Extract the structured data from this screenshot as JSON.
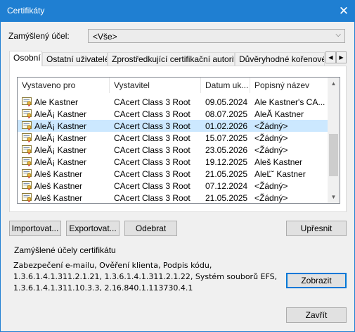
{
  "window": {
    "title": "Certifikáty",
    "close_glyph": "✕"
  },
  "purpose": {
    "label": "Zamýšlený účel:",
    "value": "<Vše>"
  },
  "tabs": [
    {
      "label": "Osobní"
    },
    {
      "label": "Ostatní uživatelé"
    },
    {
      "label": "Zprostředkující certifikační autority"
    },
    {
      "label": "Důvěryhodné kořenové certifikační autority"
    }
  ],
  "table": {
    "headers": [
      "Vystaveno pro",
      "Vystavitel",
      "Datum uk...",
      "Popisný název"
    ],
    "rows": [
      {
        "issued_to": "Ale Kastner",
        "issuer": "CAcert Class 3 Root",
        "expires": "09.05.2024",
        "friendly": "Ale Kastner's CA..."
      },
      {
        "issued_to": "AleĂ¡ Kastner",
        "issuer": "CAcert Class 3 Root",
        "expires": "08.07.2025",
        "friendly": "AleĂ Kastner"
      },
      {
        "issued_to": "AleĂ¡ Kastner",
        "issuer": "CAcert Class 3 Root",
        "expires": "01.02.2026",
        "friendly": "<Žádný>"
      },
      {
        "issued_to": "AleĂ¡ Kastner",
        "issuer": "CAcert Class 3 Root",
        "expires": "15.07.2025",
        "friendly": "<Žádný>"
      },
      {
        "issued_to": "AleĂ¡ Kastner",
        "issuer": "CAcert Class 3 Root",
        "expires": "23.05.2026",
        "friendly": "<Žádný>"
      },
      {
        "issued_to": "AleĂ¡ Kastner",
        "issuer": "CAcert Class 3 Root",
        "expires": "19.12.2025",
        "friendly": "Aleš Kastner"
      },
      {
        "issued_to": "Aleš Kastner",
        "issuer": "CAcert Class 3 Root",
        "expires": "21.05.2025",
        "friendly": "AleĽ˘ Kastner"
      },
      {
        "issued_to": "Aleš Kastner",
        "issuer": "CAcert Class 3 Root",
        "expires": "07.12.2024",
        "friendly": "<Žádný>"
      },
      {
        "issued_to": "Aleš Kastner",
        "issuer": "CAcert Class 3 Root",
        "expires": "21.05.2025",
        "friendly": "<Žádný>"
      }
    ]
  },
  "buttons": {
    "import": "Importovat...",
    "export": "Exportovat...",
    "remove": "Odebrat",
    "advanced": "Upřesnit",
    "view": "Zobrazit",
    "close": "Zavřít"
  },
  "purposes_group": {
    "title": "Zamýšlené účely certifikátu",
    "text": "Zabezpečení e-mailu, Ověření klienta, Podpis kódu, 1.3.6.1.4.1.311.2.1.21, 1.3.6.1.4.1.311.2.1.22, Systém souborů EFS, 1.3.6.1.4.1.311.10.3.3, 2.16.840.1.113730.4.1"
  },
  "colors": {
    "titlebar": "#1f7fd2",
    "selection": "#cce8ff",
    "default_button_border": "#0078d7"
  }
}
